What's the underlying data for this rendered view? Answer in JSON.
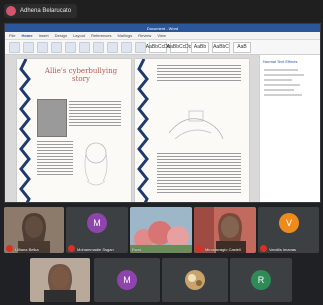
{
  "presenter": {
    "name": "Adhena Belarucato"
  },
  "word": {
    "window_title": "Document - Word",
    "ribbon_tabs": [
      "File",
      "Home",
      "Insert",
      "Design",
      "Layout",
      "References",
      "Mailings",
      "Review",
      "View"
    ],
    "style_samples": [
      "AaBbCcDc",
      "AaBbCcDc",
      "AaBb",
      "AaBbC",
      "AaB"
    ],
    "right_pane_title": "Normal Text Effects",
    "left_page_heading": "Allie's cyberbullying story"
  },
  "participants": [
    {
      "label": "Lilliana Belka",
      "avatar_letter": "",
      "muted": true
    },
    {
      "label": "Mohammadie Ssgan",
      "avatar_letter": "M",
      "muted": true
    },
    {
      "label": "Ewal",
      "avatar_letter": "",
      "muted": false
    },
    {
      "label": "Miroslavagio Castell",
      "avatar_letter": "",
      "muted": true
    },
    {
      "label": "Vandlis Imanas",
      "avatar_letter": "V",
      "muted": true
    },
    {
      "label": "",
      "avatar_letter": "",
      "muted": false
    },
    {
      "label": "",
      "avatar_letter": "M",
      "muted": false
    },
    {
      "label": "",
      "avatar_letter": "",
      "muted": false
    },
    {
      "label": "",
      "avatar_letter": "R",
      "muted": false
    }
  ],
  "colors": {
    "avatar_purple": "#8e44ad",
    "avatar_orange": "#ef8b1c",
    "avatar_green": "#2e8b57",
    "word_blue": "#2b579a",
    "muted_red": "#d93025"
  }
}
